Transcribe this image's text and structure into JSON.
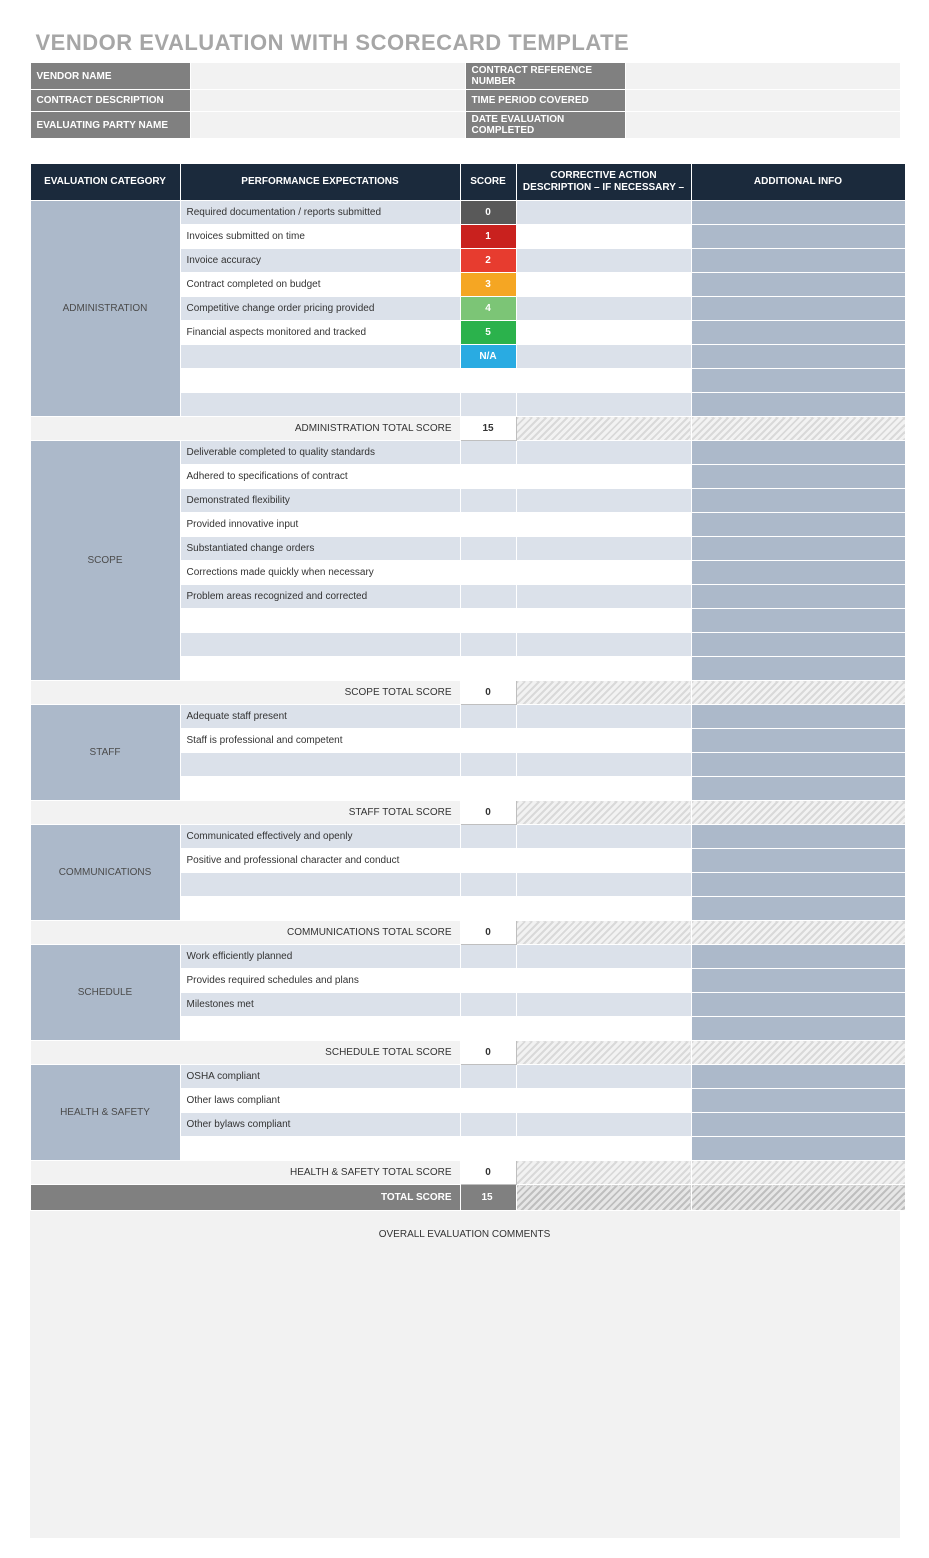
{
  "title": "VENDOR EVALUATION WITH SCORECARD TEMPLATE",
  "meta": {
    "vendor_name_label": "VENDOR NAME",
    "vendor_name_value": "",
    "contract_ref_label": "CONTRACT REFERENCE NUMBER",
    "contract_ref_value": "",
    "contract_desc_label": "CONTRACT DESCRIPTION",
    "contract_desc_value": "",
    "time_period_label": "TIME PERIOD COVERED",
    "time_period_value": "",
    "eval_party_label": "EVALUATING PARTY NAME",
    "eval_party_value": "",
    "date_completed_label": "DATE EVALUATION COMPLETED",
    "date_completed_value": ""
  },
  "headers": {
    "category": "EVALUATION CATEGORY",
    "performance": "PERFORMANCE EXPECTATIONS",
    "score": "SCORE",
    "corrective": "CORRECTIVE ACTION DESCRIPTION – IF NECESSARY –",
    "additional": "ADDITIONAL INFO"
  },
  "sections": [
    {
      "name": "ADMINISTRATION",
      "subtotal_label": "ADMINISTRATION TOTAL SCORE",
      "subtotal": "15",
      "rows": [
        {
          "perf": "Required documentation / reports submitted",
          "score": "0",
          "score_class": "sc-0"
        },
        {
          "perf": "Invoices submitted on time",
          "score": "1",
          "score_class": "sc-1"
        },
        {
          "perf": "Invoice accuracy",
          "score": "2",
          "score_class": "sc-2"
        },
        {
          "perf": "Contract completed on budget",
          "score": "3",
          "score_class": "sc-3"
        },
        {
          "perf": "Competitive change order pricing provided",
          "score": "4",
          "score_class": "sc-4"
        },
        {
          "perf": "Financial aspects monitored and tracked",
          "score": "5",
          "score_class": "sc-5"
        },
        {
          "perf": "",
          "score": "N/A",
          "score_class": "sc-na"
        },
        {
          "perf": "",
          "score": "",
          "score_class": ""
        },
        {
          "perf": "",
          "score": "",
          "score_class": ""
        }
      ]
    },
    {
      "name": "SCOPE",
      "subtotal_label": "SCOPE TOTAL SCORE",
      "subtotal": "0",
      "rows": [
        {
          "perf": "Deliverable completed to quality standards",
          "score": "",
          "score_class": ""
        },
        {
          "perf": "Adhered to specifications of contract",
          "score": "",
          "score_class": ""
        },
        {
          "perf": "Demonstrated flexibility",
          "score": "",
          "score_class": ""
        },
        {
          "perf": "Provided innovative input",
          "score": "",
          "score_class": ""
        },
        {
          "perf": "Substantiated change orders",
          "score": "",
          "score_class": ""
        },
        {
          "perf": "Corrections made quickly when necessary",
          "score": "",
          "score_class": ""
        },
        {
          "perf": "Problem areas recognized and corrected",
          "score": "",
          "score_class": ""
        },
        {
          "perf": "",
          "score": "",
          "score_class": ""
        },
        {
          "perf": "",
          "score": "",
          "score_class": ""
        },
        {
          "perf": "",
          "score": "",
          "score_class": ""
        }
      ]
    },
    {
      "name": "STAFF",
      "subtotal_label": "STAFF TOTAL SCORE",
      "subtotal": "0",
      "rows": [
        {
          "perf": "Adequate staff present",
          "score": "",
          "score_class": ""
        },
        {
          "perf": "Staff is professional and competent",
          "score": "",
          "score_class": ""
        },
        {
          "perf": "",
          "score": "",
          "score_class": ""
        },
        {
          "perf": "",
          "score": "",
          "score_class": ""
        }
      ]
    },
    {
      "name": "COMMUNICATIONS",
      "subtotal_label": "COMMUNICATIONS TOTAL SCORE",
      "subtotal": "0",
      "rows": [
        {
          "perf": "Communicated effectively and openly",
          "score": "",
          "score_class": ""
        },
        {
          "perf": "Positive and professional character and conduct",
          "score": "",
          "score_class": ""
        },
        {
          "perf": "",
          "score": "",
          "score_class": ""
        },
        {
          "perf": "",
          "score": "",
          "score_class": ""
        }
      ]
    },
    {
      "name": "SCHEDULE",
      "subtotal_label": "SCHEDULE TOTAL SCORE",
      "subtotal": "0",
      "rows": [
        {
          "perf": "Work efficiently planned",
          "score": "",
          "score_class": ""
        },
        {
          "perf": "Provides required schedules and plans",
          "score": "",
          "score_class": ""
        },
        {
          "perf": "Milestones met",
          "score": "",
          "score_class": ""
        },
        {
          "perf": "",
          "score": "",
          "score_class": ""
        }
      ]
    },
    {
      "name": "HEALTH & SAFETY",
      "subtotal_label": "HEALTH & SAFETY TOTAL SCORE",
      "subtotal": "0",
      "rows": [
        {
          "perf": "OSHA compliant",
          "score": "",
          "score_class": ""
        },
        {
          "perf": "Other laws compliant",
          "score": "",
          "score_class": ""
        },
        {
          "perf": "Other bylaws compliant",
          "score": "",
          "score_class": ""
        },
        {
          "perf": "",
          "score": "",
          "score_class": ""
        }
      ]
    }
  ],
  "grand_total_label": "TOTAL SCORE",
  "grand_total": "15",
  "comments_label": "OVERALL EVALUATION COMMENTS",
  "comments_value": ""
}
